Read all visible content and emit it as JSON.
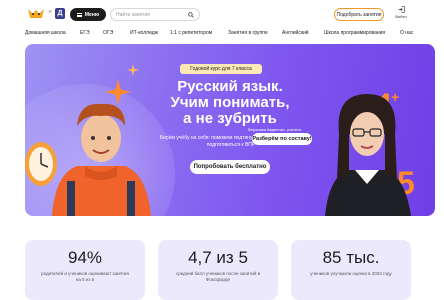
{
  "header": {
    "logo_cross": "×",
    "logo2_letter": "Д",
    "menu_label": "Меню",
    "search_placeholder": "Найти занятия",
    "pick_button": "Подобрать занятия",
    "login_label": "Войти"
  },
  "nav": {
    "items": [
      "Домашняя школа",
      "ЕГЭ",
      "ОГЭ",
      "ИТ-колледж",
      "1:1 с репетитором",
      "Занятия в группе",
      "Английский",
      "Школа программирования",
      "О нас"
    ]
  },
  "hero": {
    "badge": "Годовой курс для 7 класса",
    "title_lines": [
      "Русский язык.",
      "Учим понимать,",
      "а не зубрить"
    ],
    "subtitle": "Берём учёбу на себя: поможем подтянуть оценки и уверенно подготовиться к ВПР",
    "cta": "Попробовать бесплатно",
    "teacher_name": "Вероника Авдеенко, учитель",
    "bubble_text": "Разберём по составу!"
  },
  "stats": [
    {
      "value": "94%",
      "label": "родителей и учеников оценивают занятия на 5 из 5"
    },
    {
      "value": "4,7 из 5",
      "label": "средний балл учеников после занятий в Фоксфорде"
    },
    {
      "value": "85 тыс.",
      "label": "учеников улучшили оценки в 2023 году"
    }
  ],
  "colors": {
    "accent_orange": "#f0962a",
    "hero_purple": "#7f56ef",
    "stat_card_bg": "#ede9fd"
  }
}
